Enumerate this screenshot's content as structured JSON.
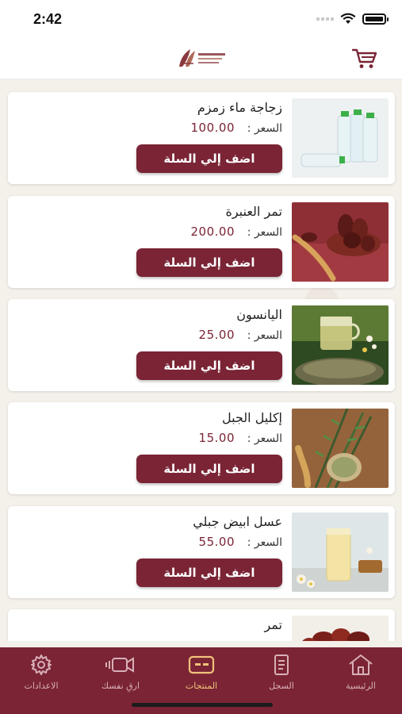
{
  "status_bar": {
    "time": "2:42"
  },
  "header": {
    "logo": "brand-logo",
    "cart_icon": "cart-icon"
  },
  "products": [
    {
      "name": "زجاجة ماء زمزم",
      "price_label": "السعر :",
      "price": "100.00",
      "button": "اضف إلي السلة",
      "image": "water-bottles"
    },
    {
      "name": "تمر العنبرة",
      "price_label": "السعر :",
      "price": "200.00",
      "button": "اضف إلي السلة",
      "image": "dates-bowl"
    },
    {
      "name": "اليانسون",
      "price_label": "السعر :",
      "price": "25.00",
      "button": "اضف إلي السلة",
      "image": "anise-tea"
    },
    {
      "name": "إكليل الجبل",
      "price_label": "السعر :",
      "price": "15.00",
      "button": "اضف إلي السلة",
      "image": "rosemary"
    },
    {
      "name": "عسل ابيض جبلي",
      "price_label": "السعر :",
      "price": "55.00",
      "button": "اضف إلي السلة",
      "image": "white-honey"
    },
    {
      "name": "تمر",
      "image": "dates"
    }
  ],
  "tabbar": {
    "items": [
      {
        "label": "الاعدادات",
        "icon": "gear-icon"
      },
      {
        "label": "ارقِ نفسك",
        "icon": "video-camera-icon"
      },
      {
        "label": "المنتجات",
        "icon": "products-icon",
        "active": true
      },
      {
        "label": "السجل",
        "icon": "record-icon"
      },
      {
        "label": "الرئيسية",
        "icon": "home-icon"
      }
    ]
  },
  "colors": {
    "brand": "#7a2435",
    "active_tab": "#f1c27a",
    "background": "#f4f0ea"
  }
}
